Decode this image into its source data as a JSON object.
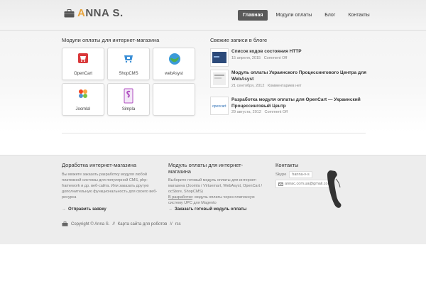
{
  "header": {
    "logo_first": "A",
    "logo_rest": "NNA S."
  },
  "nav": [
    {
      "label": "Главная",
      "active": true
    },
    {
      "label": "Модули оплаты",
      "active": false
    },
    {
      "label": "Блог",
      "active": false
    },
    {
      "label": "Контакты",
      "active": false
    }
  ],
  "modules": {
    "title": "Модули оплаты для интернет-магазина",
    "tiles": [
      {
        "caption": "OpenCart",
        "icon": "opencart-icon"
      },
      {
        "caption": "ShopCMS",
        "icon": "shopcms-icon"
      },
      {
        "caption": "webAsyst",
        "icon": "webasyst-icon"
      },
      {
        "caption": "Joomla!",
        "icon": "joomla-icon"
      },
      {
        "caption": "Simpla",
        "icon": "simpla-icon"
      },
      {
        "caption": "",
        "icon": ""
      }
    ]
  },
  "blog": {
    "title": "Свежие записи в блоге",
    "posts": [
      {
        "title": "Список кодов состояния HTTP",
        "date": "15 апреля, 2015",
        "comments": "Comment Off"
      },
      {
        "title": "Модуль оплаты Украинского Процессингового Центра для WebAsyst",
        "date": "21 сентября, 2012",
        "comments": "Комментариев нет"
      },
      {
        "title": "Разработка модуля оплаты для OpenCart — Украинский Процессинговый Центр",
        "date": "29 августа, 2012",
        "comments": "Comment Off"
      }
    ]
  },
  "footer": {
    "col1": {
      "title": "Доработка интернет-магазина",
      "text": "Вы можете заказать разработку модуля любой платежной системы для популярной CMS, php-framework и др. веб-сайта. Или заказать другую дополнительную функциональность для своего веб-ресурса",
      "link": "Отправить заявку"
    },
    "col2": {
      "title": "Модуль оплаты для интернет-магазина",
      "text": "Выберите готовый модуль оплаты для интернет-магазина (Joomla / Virtuemart, WebAsyst, OpenCart / ocStore, ShopCMS)",
      "dev_label": "В разработке",
      "dev_text": ": модуль оплаты через платежную систему UPC для Magento",
      "link": "Заказать готовый модуль оплаты"
    },
    "col3": {
      "title": "Контакты",
      "skype_label": "Skype",
      "skype_value": "hanna-v-s",
      "email": "annac.com.ua@gmail.com"
    },
    "copyright": "Copyright © Anna S.",
    "links": [
      "Карта сайта для роботов",
      "rss"
    ],
    "sep": "//"
  },
  "colors": {
    "accent": "#e8a33c",
    "nav_active": "#5a5a5a",
    "footer_bg": "#ededed"
  }
}
